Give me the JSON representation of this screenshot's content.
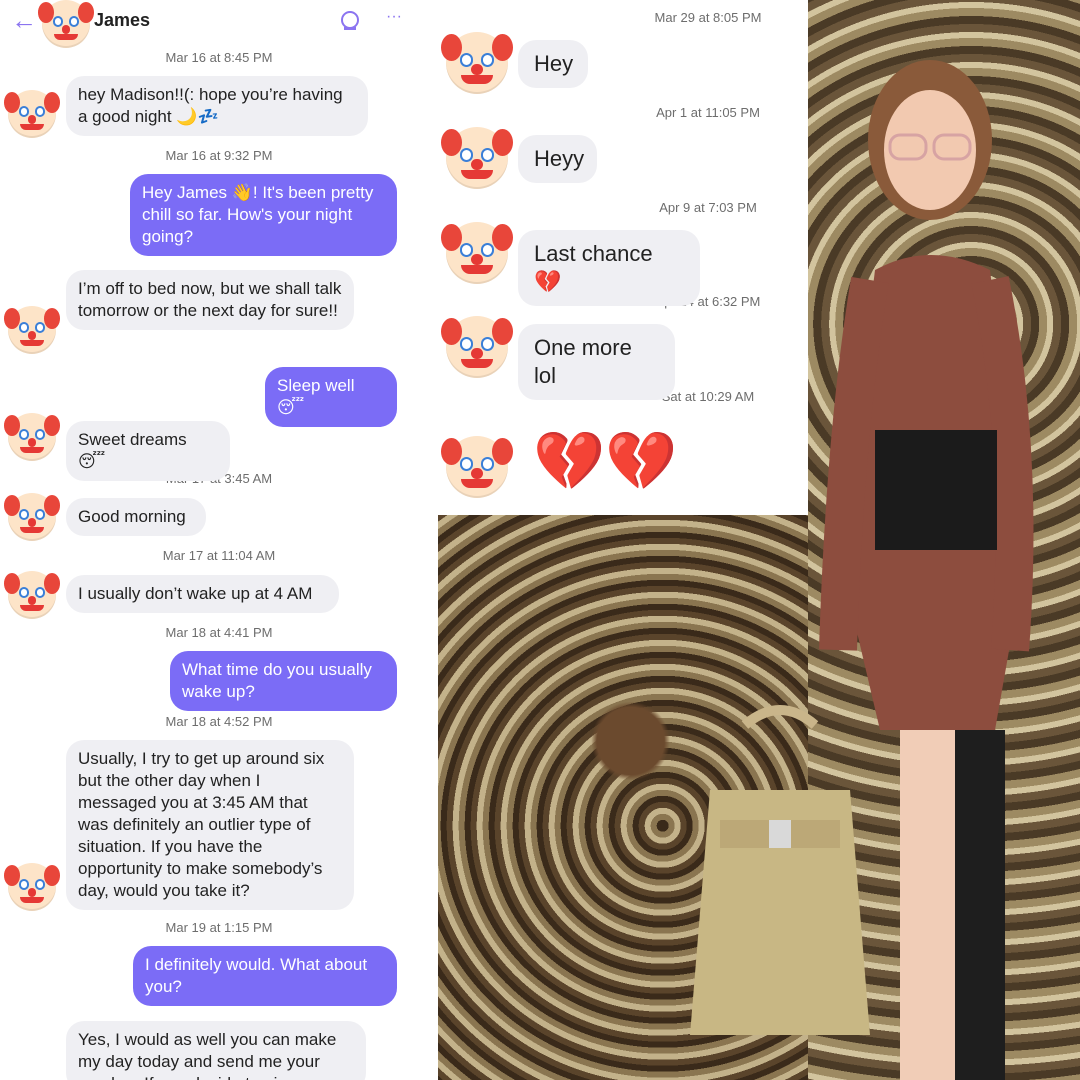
{
  "header": {
    "contact_name": "James",
    "back_label": "←",
    "more_label": "···"
  },
  "left_thread": [
    {
      "kind": "stamp",
      "text": "Mar 16 at 8:45 PM"
    },
    {
      "kind": "in",
      "text": "hey Madison!!(: hope you’re having a good night 🌙💤"
    },
    {
      "kind": "stamp",
      "text": "Mar 16 at 9:32 PM"
    },
    {
      "kind": "out",
      "text": "Hey James 👋! It's been pretty chill so far. How's your night going?"
    },
    {
      "kind": "in",
      "text": "I’m off to bed now, but we shall talk tomorrow or the next day for sure!!"
    },
    {
      "kind": "out",
      "text": "Sleep well 😴"
    },
    {
      "kind": "in",
      "text": "Sweet dreams 😴"
    },
    {
      "kind": "stamp",
      "text": "Mar 17 at 3:45 AM"
    },
    {
      "kind": "in",
      "text": "Good morning"
    },
    {
      "kind": "stamp",
      "text": "Mar 17 at 11:04 AM"
    },
    {
      "kind": "in",
      "text": "I usually don’t wake up at 4 AM"
    },
    {
      "kind": "stamp",
      "text": "Mar 18 at 4:41 PM"
    },
    {
      "kind": "out",
      "text": "What time do you usually wake up?"
    },
    {
      "kind": "stamp",
      "text": "Mar 18 at 4:52 PM"
    },
    {
      "kind": "in",
      "text": "Usually, I try to get up around six but the other day when I messaged you at 3:45 AM that was definitely an outlier type of situation. If you have the opportunity to make somebody’s day, would you take it?"
    },
    {
      "kind": "stamp",
      "text": "Mar 19 at 1:15 PM"
    },
    {
      "kind": "out",
      "text": "I definitely would. What about you?"
    },
    {
      "kind": "in",
      "text": "Yes, I would as well you can make my day today and send me your number. If you decide to give me"
    }
  ],
  "right_thread": [
    {
      "kind": "stamp",
      "text": "Mar 29 at 8:05 PM"
    },
    {
      "kind": "in",
      "text": "Hey"
    },
    {
      "kind": "stamp",
      "text": "Apr 1 at 11:05 PM"
    },
    {
      "kind": "in",
      "text": "Heyy"
    },
    {
      "kind": "stamp",
      "text": "Apr 9 at 7:03 PM"
    },
    {
      "kind": "in",
      "text": "Last chance 💔"
    },
    {
      "kind": "stamp",
      "text": "Apr 24 at 6:32 PM"
    },
    {
      "kind": "in",
      "text": "One more lol"
    },
    {
      "kind": "stamp",
      "text": "Sat at 10:29 AM"
    },
    {
      "kind": "emoji",
      "text": "💔💔"
    }
  ],
  "colors": {
    "accent": "#8b74f0",
    "outgoing_bubble": "#7b6cf6",
    "incoming_bubble": "#efeff3"
  }
}
